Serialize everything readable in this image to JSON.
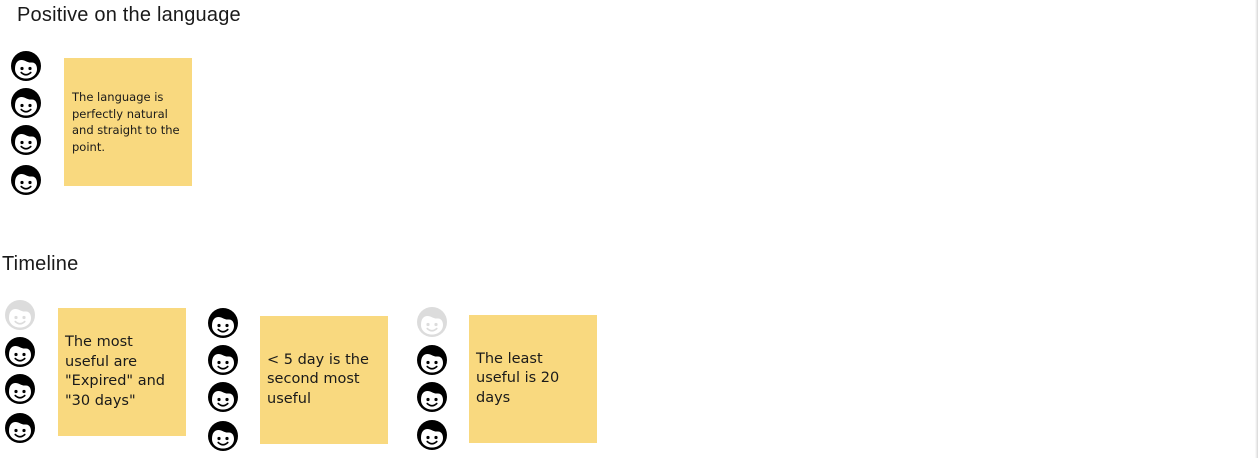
{
  "sections": [
    {
      "title": "Positive on the language",
      "groups": [
        {
          "votes": 4,
          "faded": 0,
          "note": "The language is perfectly natural and straight to the point."
        }
      ]
    },
    {
      "title": "Timeline",
      "groups": [
        {
          "votes": 3,
          "faded": 1,
          "note": "The most useful are \"Expired\" and \"30 days\""
        },
        {
          "votes": 4,
          "faded": 0,
          "note": "< 5 day is the second most useful"
        },
        {
          "votes": 3,
          "faded": 1,
          "note": "The least useful is 20 days"
        }
      ]
    }
  ],
  "colors": {
    "sticky": "#f9d97f",
    "face_active": "#000000",
    "face_faded": "#dcdcdc"
  },
  "icons": {
    "vote": "smiley-face-icon"
  }
}
